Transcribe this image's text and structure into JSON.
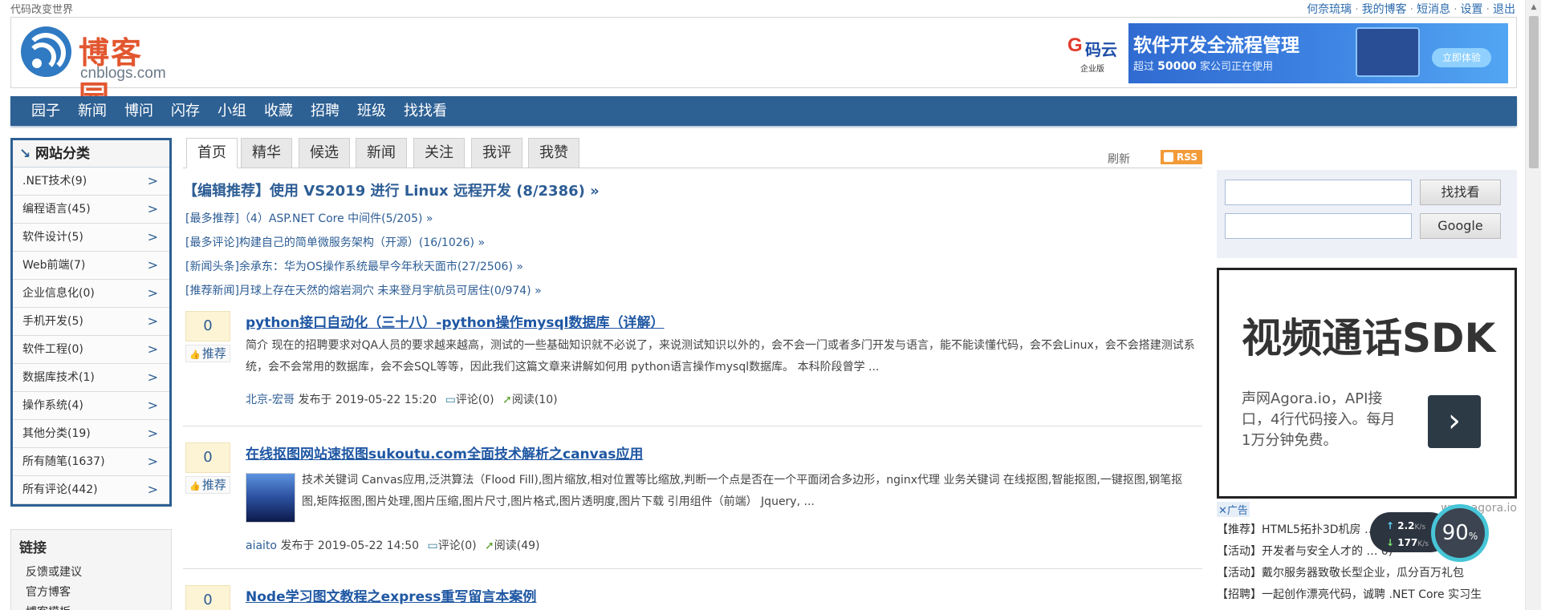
{
  "topbar": {
    "slogan": "代码改变世界",
    "links": [
      "何奈琉璃",
      "我的博客",
      "短消息",
      "设置",
      "退出"
    ],
    "separator": "·"
  },
  "logo": {
    "name": "博客园",
    "domain": "cnblogs.com"
  },
  "banner": {
    "logo_g": "G",
    "brand": "码云",
    "edition": "企业版",
    "title": "软件开发全流程管理",
    "sub_prefix": "超过",
    "sub_number": "50000",
    "sub_suffix": "家公司正在使用",
    "cta": "立即体验"
  },
  "nav": [
    "园子",
    "新闻",
    "博问",
    "闪存",
    "小组",
    "收藏",
    "招聘",
    "班级",
    "找找看"
  ],
  "categories": {
    "title": "网站分类",
    "items": [
      ".NET技术(9)",
      "编程语言(45)",
      "软件设计(5)",
      "Web前端(7)",
      "企业信息化(0)",
      "手机开发(5)",
      "软件工程(0)",
      "数据库技术(1)",
      "操作系统(4)",
      "其他分类(19)",
      "所有随笔(1637)",
      "所有评论(442)"
    ]
  },
  "links_box": {
    "title": "链接",
    "items": [
      "反馈或建议",
      "官方博客",
      "博客模板"
    ]
  },
  "tabs": [
    "首页",
    "精华",
    "候选",
    "新闻",
    "关注",
    "我评",
    "我赞"
  ],
  "refresh": "刷新",
  "rss": "RSS",
  "editor_pick": "【编辑推荐】使用 VS2019 进行 Linux 远程开发 (8/2386) »",
  "headlines": [
    "[最多推荐]（4）ASP.NET Core 中间件(5/205) »",
    "[最多评论]构建自己的简单微服务架构（开源）(16/1026) »",
    "[新闻头条]余承东：华为OS操作系统最早今年秋天面市(27/2506) »",
    "[推荐新闻]月球上存在天然的熔岩洞穴 未来登月宇航员可居住(0/974) »"
  ],
  "recommend_label": "推荐",
  "posts": [
    {
      "votes": "0",
      "title": "python接口自动化（三十八）-python操作mysql数据库（详解）",
      "summary": "简介 现在的招聘要求对QA人员的要求越来越高，测试的一些基础知识就不必说了，来说测试知识以外的，会不会一门或者多门开发与语言，能不能读懂代码，会不会Linux，会不会搭建测试系统，会不会常用的数据库，会不会SQL等等，因此我们这篇文章来讲解如何用 python语言操作mysql数据库。 本科阶段曾学 ...",
      "author": "北京-宏哥",
      "published": "发布于 2019-05-22 15:20",
      "comments": "评论(0)",
      "reads": "阅读(10)"
    },
    {
      "votes": "0",
      "title": "在线抠图网站速抠图sukoutu.com全面技术解析之canvas应用",
      "summary": "技术关键词 Canvas应用,泛洪算法（Flood Fill),图片缩放,相对位置等比缩放,判断一个点是否在一个平面闭合多边形，nginx代理 业务关键词 在线抠图,智能抠图,一键抠图,钢笔抠图,矩阵抠图,图片处理,图片压缩,图片尺寸,图片格式,图片透明度,图片下载 引用组件（前端） Jquery, ...",
      "author": "aiaito",
      "published": "发布于 2019-05-22 14:50",
      "comments": "评论(0)",
      "reads": "阅读(49)"
    },
    {
      "votes": "0",
      "title": "Node学习图文教程之express重写留言本案例"
    }
  ],
  "search": {
    "button1": "找找看",
    "button2": "Google"
  },
  "ad": {
    "headline": "视频通话SDK",
    "desc": "声网Agora.io，API接口，4行代码接入。每月1万分钟免费。",
    "close": "✕广告",
    "source": "www.agora.io"
  },
  "news": [
    "【推荐】HTML5拓扑3D机房 … DA",
    "【活动】开发者与安全人才的 … 0)",
    "【活动】戴尔服务器致敬长型企业，瓜分百万礼包",
    "【招聘】一起创作漂亮代码，诚聘 .NET Core 实习生"
  ],
  "widget": {
    "up": "2.2",
    "up_unit": "K/s",
    "down": "177",
    "down_unit": "K/s",
    "percent": "90",
    "percent_unit": "%"
  }
}
